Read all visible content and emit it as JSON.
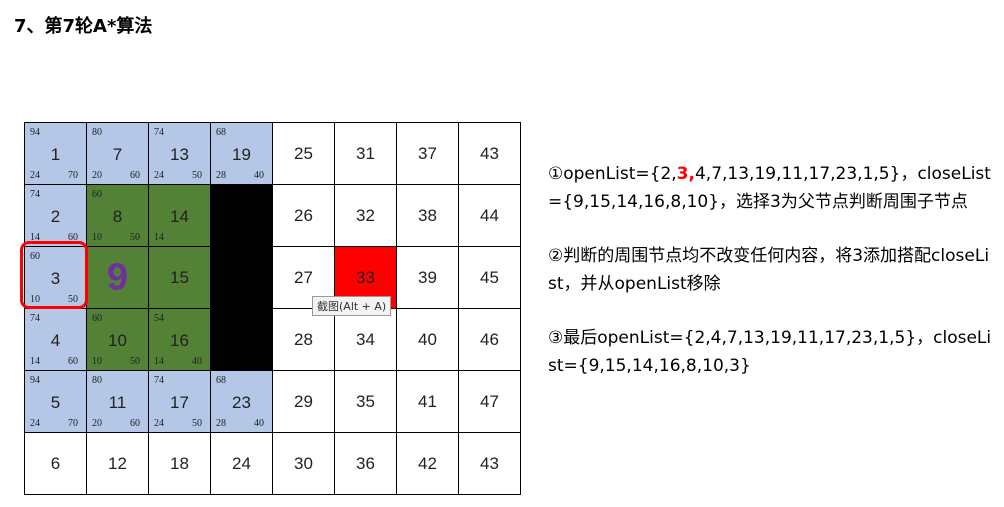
{
  "title": "7、第7轮A*算法",
  "colors": {
    "blue": "#b4c7e7",
    "green": "#538135",
    "black": "#000000",
    "red": "#ff0000",
    "purple": "#7030a0"
  },
  "grid": {
    "rows": [
      [
        {
          "id": "1",
          "f": "94",
          "g": "24",
          "h": "70",
          "color": "blue"
        },
        {
          "id": "7",
          "f": "80",
          "g": "20",
          "h": "60",
          "color": "blue"
        },
        {
          "id": "13",
          "f": "74",
          "g": "24",
          "h": "50",
          "color": "blue"
        },
        {
          "id": "19",
          "f": "68",
          "g": "28",
          "h": "40",
          "color": "blue"
        },
        {
          "id": "25"
        },
        {
          "id": "31"
        },
        {
          "id": "37"
        },
        {
          "id": "43"
        }
      ],
      [
        {
          "id": "2",
          "f": "74",
          "g": "14",
          "h": "60",
          "color": "blue"
        },
        {
          "id": "8",
          "f": "60",
          "g": "10",
          "h": "50",
          "color": "green"
        },
        {
          "id": "14",
          "g": "14",
          "color": "green"
        },
        {
          "color": "black"
        },
        {
          "id": "26"
        },
        {
          "id": "32"
        },
        {
          "id": "38"
        },
        {
          "id": "44"
        }
      ],
      [
        {
          "id": "3",
          "f": "60",
          "g": "10",
          "h": "50",
          "color": "blue"
        },
        {
          "big": "9",
          "color": "green"
        },
        {
          "id": "15",
          "color": "green"
        },
        {
          "color": "black"
        },
        {
          "id": "27"
        },
        {
          "id": "33",
          "color": "red"
        },
        {
          "id": "39"
        },
        {
          "id": "45"
        }
      ],
      [
        {
          "id": "4",
          "f": "74",
          "g": "14",
          "h": "60",
          "color": "blue"
        },
        {
          "id": "10",
          "f": "60",
          "g": "10",
          "h": "50",
          "color": "green"
        },
        {
          "id": "16",
          "f": "54",
          "g": "14",
          "h": "40",
          "color": "green"
        },
        {
          "color": "black"
        },
        {
          "id": "28"
        },
        {
          "id": "34"
        },
        {
          "id": "40"
        },
        {
          "id": "46"
        }
      ],
      [
        {
          "id": "5",
          "f": "94",
          "g": "24",
          "h": "70",
          "color": "blue"
        },
        {
          "id": "11",
          "f": "80",
          "g": "20",
          "h": "60",
          "color": "blue"
        },
        {
          "id": "17",
          "f": "74",
          "g": "24",
          "h": "50",
          "color": "blue"
        },
        {
          "id": "23",
          "f": "68",
          "g": "28",
          "h": "40",
          "color": "blue"
        },
        {
          "id": "29"
        },
        {
          "id": "35"
        },
        {
          "id": "41"
        },
        {
          "id": "47"
        }
      ],
      [
        {
          "id": "6"
        },
        {
          "id": "12"
        },
        {
          "id": "18"
        },
        {
          "id": "24"
        },
        {
          "id": "30"
        },
        {
          "id": "36"
        },
        {
          "id": "42"
        },
        {
          "id": "43"
        }
      ]
    ]
  },
  "tooltip": "截图(Alt + A)",
  "panel": {
    "p1_pre": "①openList={2,",
    "p1_highlight": "3,",
    "p1_post": "4,7,13,19,11,17,23,1,5}，closeList={9,15,14,16,8,10}，选择3为父节点判断周围子节点",
    "p2": "②判断的周围节点均不改变任何内容，将3添加搭配closeList，并从openList移除",
    "p3": "③最后openList={2,4,7,13,19,11,17,23,1,5}，closeList={9,15,14,16,8,10,3}"
  }
}
